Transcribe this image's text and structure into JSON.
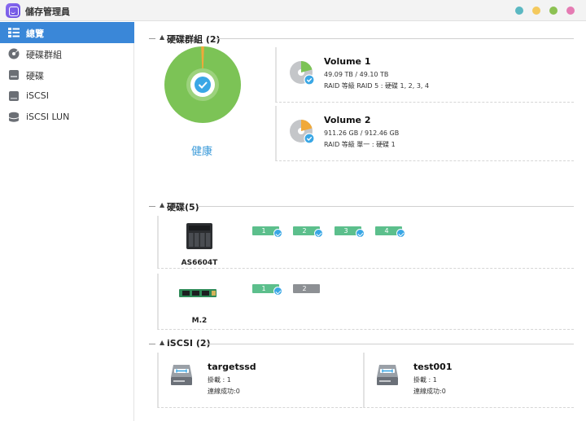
{
  "window": {
    "title": "儲存管理員",
    "controls": [
      {
        "name": "window-dot-teal",
        "color": "#5bb8c2"
      },
      {
        "name": "window-dot-yellow",
        "color": "#f4c95d"
      },
      {
        "name": "window-dot-green",
        "color": "#8cc152"
      },
      {
        "name": "window-dot-pink",
        "color": "#e57bb3"
      }
    ]
  },
  "sidebar": {
    "items": [
      {
        "label": "總覽",
        "icon": "overview-list-icon",
        "active": true
      },
      {
        "label": "硬碟群組",
        "icon": "disk-group-icon",
        "active": false
      },
      {
        "label": "硬碟",
        "icon": "hdd-icon",
        "active": false
      },
      {
        "label": "iSCSI",
        "icon": "iscsi-icon",
        "active": false
      },
      {
        "label": "iSCSI LUN",
        "icon": "lun-stack-icon",
        "active": false
      }
    ]
  },
  "colors": {
    "accent": "#3a87d8",
    "healthy": "#7cc356",
    "check": "#3aa7e5",
    "bay_ok": "#5cbf8c",
    "bay_empty": "#8d9094",
    "used_slice": "#f0a93a"
  },
  "disk_groups": {
    "title": "硬碟群組 (2)",
    "status_label": "健康",
    "volumes": [
      {
        "name": "Volume 1",
        "size": "49.09 TB / 49.10 TB",
        "raid": "RAID 等級 RAID 5 : 硬碟 1, 2, 3, 4"
      },
      {
        "name": "Volume 2",
        "size": "911.26 GB / 912.46 GB",
        "raid": "RAID 等級 單一 : 硬碟 1"
      }
    ]
  },
  "disks": {
    "title": "硬碟(5)",
    "enclosures": [
      {
        "name": "AS6604T",
        "bays": [
          {
            "label": "1",
            "ok": true
          },
          {
            "label": "2",
            "ok": true
          },
          {
            "label": "3",
            "ok": true
          },
          {
            "label": "4",
            "ok": true
          }
        ]
      },
      {
        "name": "M.2",
        "bays": [
          {
            "label": "1",
            "ok": true
          },
          {
            "label": "2",
            "ok": false
          }
        ]
      }
    ]
  },
  "iscsi": {
    "title": "iSCSI (2)",
    "targets": [
      {
        "name": "targetssd",
        "mounted": "掛載 : 1",
        "connected": "連線成功:0"
      },
      {
        "name": "test001",
        "mounted": "掛載 : 1",
        "connected": "連線成功:0"
      }
    ]
  }
}
